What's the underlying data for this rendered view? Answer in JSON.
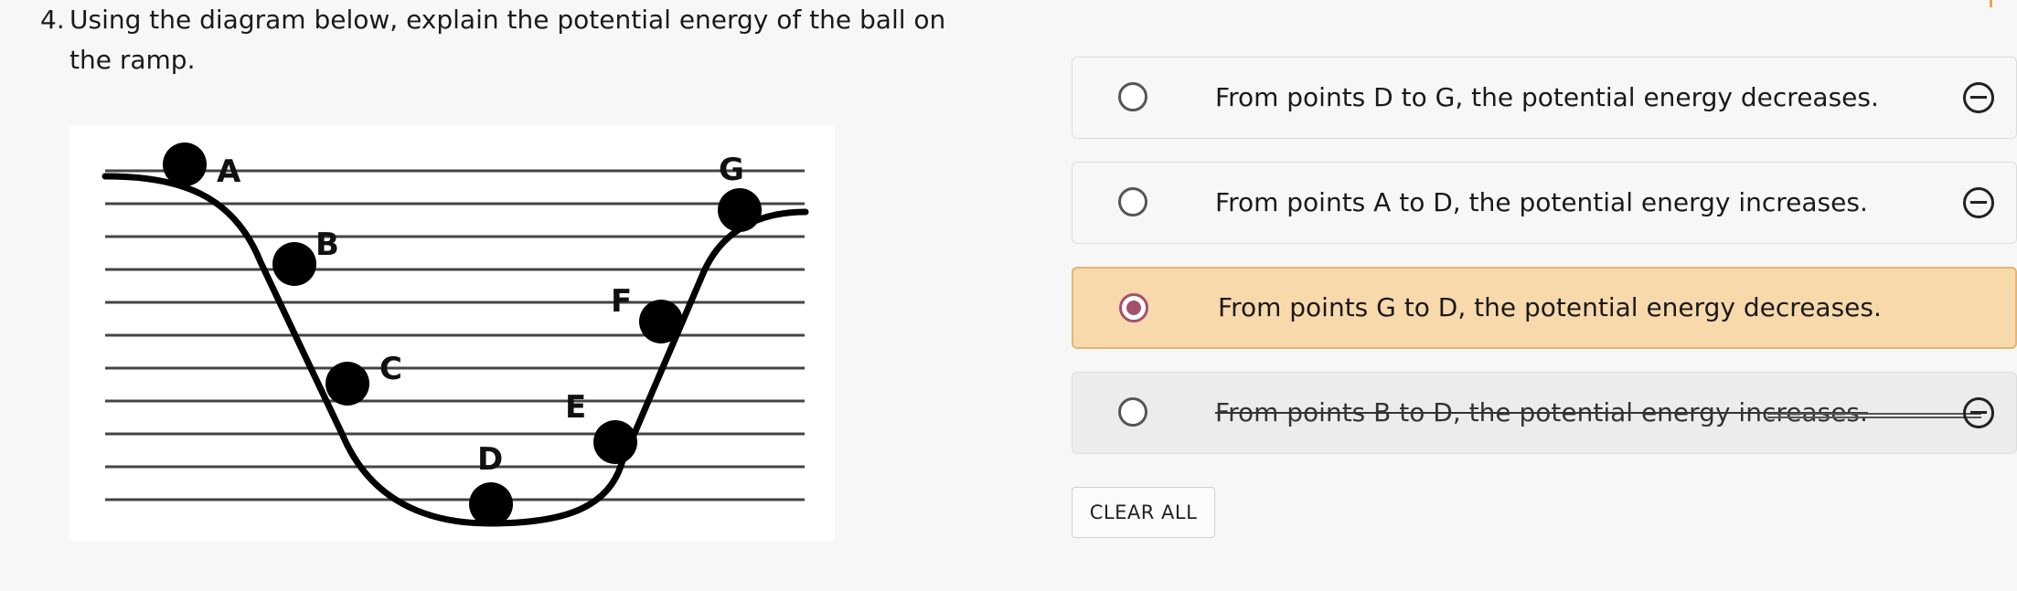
{
  "question": {
    "number": "4.",
    "text": "Using the diagram below, explain the potential energy of the ball on the ramp."
  },
  "diagram": {
    "labels": {
      "a": "A",
      "b": "B",
      "c": "C",
      "d": "D",
      "e": "E",
      "f": "F",
      "g": "G"
    }
  },
  "choices": [
    {
      "label": "From points D to G, the potential energy decreases.",
      "state": "default"
    },
    {
      "label": "From points A to D, the potential energy increases.",
      "state": "default"
    },
    {
      "label": "From points G to D, the potential energy decreases.",
      "state": "selected"
    },
    {
      "label": "From points B to D, the potential energy increases.",
      "state": "eliminated"
    }
  ],
  "clear_all_label": "CLEAR ALL",
  "colors": {
    "selected_bg": "#f7d9ac",
    "selected_border": "#e2b574",
    "radio_selected": "#a3506e"
  },
  "icons": {
    "radio": "radio-button",
    "eliminate": "minus-circle-icon"
  }
}
